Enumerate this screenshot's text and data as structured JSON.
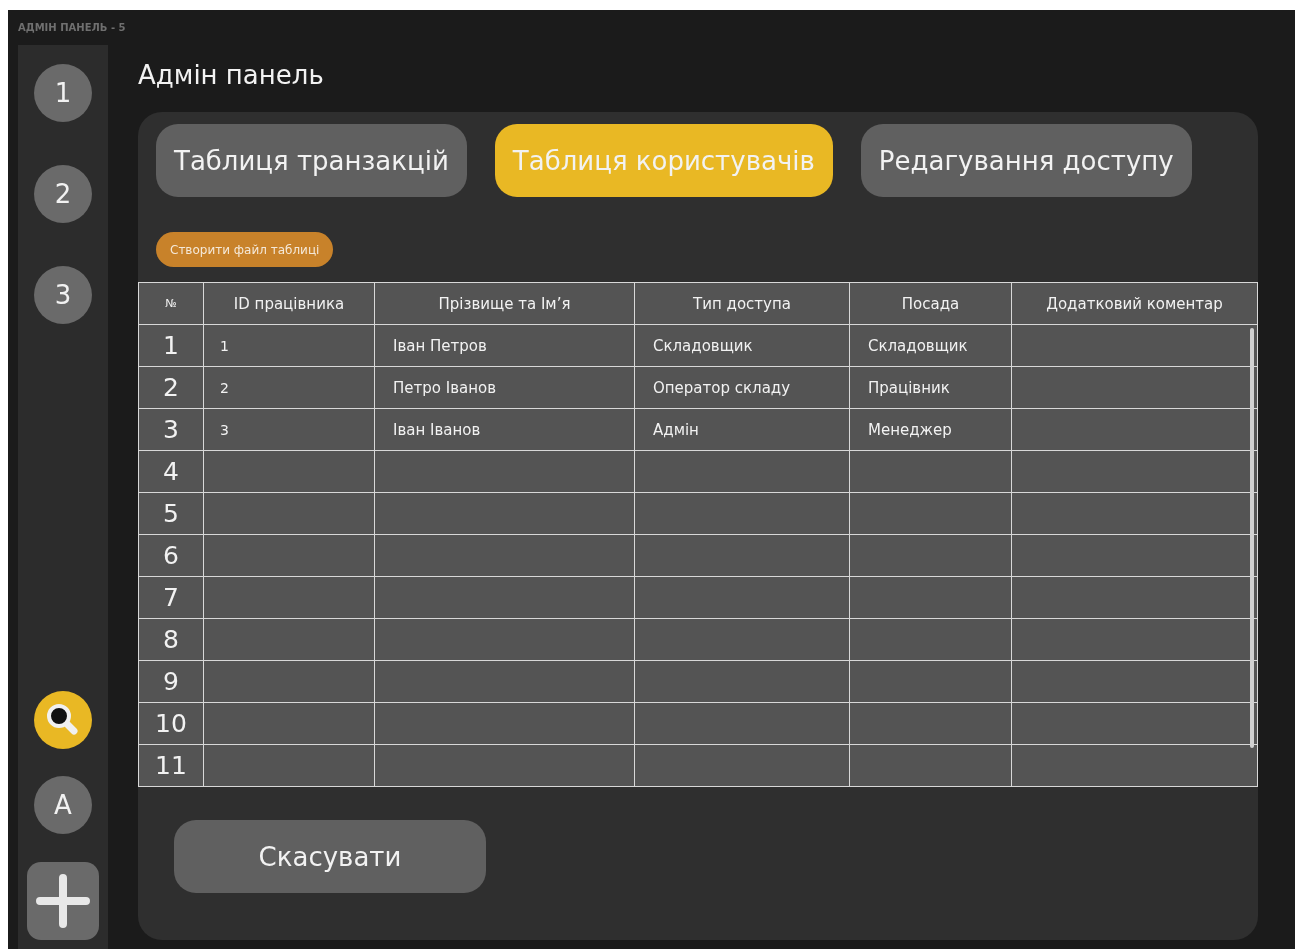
{
  "window": {
    "title": "АДМІН ПАНЕЛЬ - 5"
  },
  "sidebar": {
    "items": [
      {
        "kind": "circle",
        "label": "1",
        "selected": false
      },
      {
        "kind": "circle",
        "label": "2",
        "selected": false
      },
      {
        "kind": "circle",
        "label": "3",
        "selected": false
      },
      {
        "kind": "search",
        "selected": true
      },
      {
        "kind": "circle",
        "label": "A",
        "selected": false
      },
      {
        "kind": "add",
        "selected": false
      }
    ]
  },
  "page": {
    "title": "Адмін панель"
  },
  "tabs": [
    {
      "label": "Таблиця транзакцій",
      "selected": false
    },
    {
      "label": "Таблиця користувачів",
      "selected": true
    },
    {
      "label": "Редагування доступу",
      "selected": false
    }
  ],
  "create_button": "Створити файл таблиці",
  "table": {
    "columns": [
      "№",
      "ID працівника",
      "Прізвище та Ім’я",
      "Тип доступа",
      "Посада",
      "Додатковий коментар"
    ],
    "rows": [
      {
        "no": "1",
        "cells": [
          "1",
          "Іван Петров",
          "Складовщик",
          "Складовщик"
        ]
      },
      {
        "no": "2",
        "cells": [
          "2",
          "Петро Іванов",
          "Оператор складу",
          "Працівник"
        ]
      },
      {
        "no": "3",
        "cells": [
          "3",
          "Іван Іванов",
          "Адмін",
          "Менеджер"
        ]
      },
      {
        "no": "4"
      },
      {
        "no": "5"
      },
      {
        "no": "6"
      },
      {
        "no": "7"
      },
      {
        "no": "8"
      },
      {
        "no": "9"
      },
      {
        "no": "10"
      },
      {
        "no": "11"
      }
    ]
  },
  "cancel_button": "Скасувати"
}
